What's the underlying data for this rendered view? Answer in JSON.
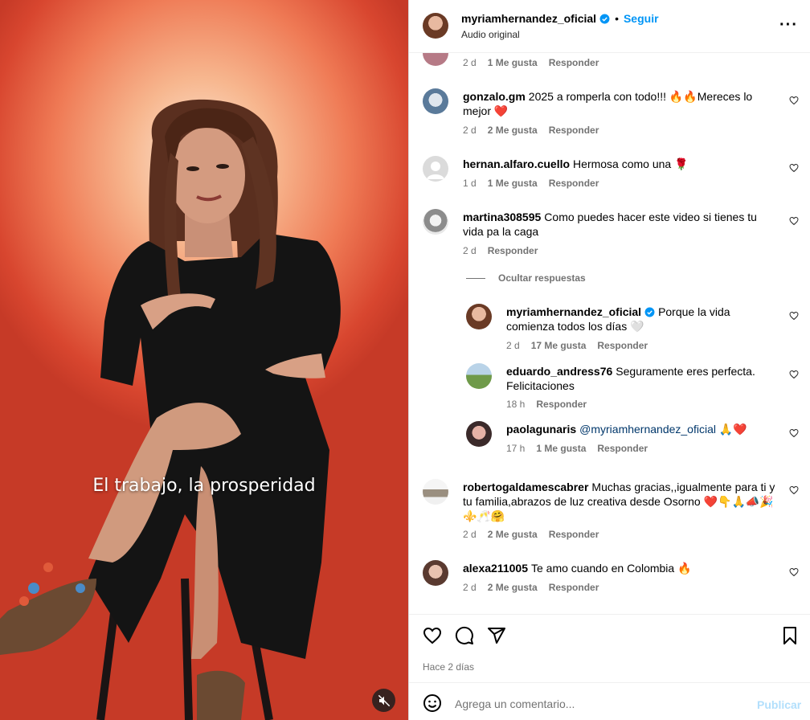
{
  "video": {
    "subtitle": "El trabajo, la prosperidad",
    "mute_icon": "speaker-muted-icon"
  },
  "post": {
    "author": "myriamhernandez_oficial",
    "separator": "•",
    "follow_label": "Seguir",
    "audio": "Audio original",
    "time_ago": "Hace 2 días"
  },
  "comments": [
    {
      "meta": {
        "age": "2 d",
        "likes": "1 Me gusta",
        "reply": "Responder"
      }
    },
    {
      "user": "gonzalo.gm",
      "text": "2025 a romperla con todo!!! 🔥🔥Mereces lo mejor ❤️",
      "meta": {
        "age": "2 d",
        "likes": "2 Me gusta",
        "reply": "Responder"
      }
    },
    {
      "user": "hernan.alfaro.cuello",
      "text": "Hermosa como una 🌹",
      "meta": {
        "age": "1 d",
        "likes": "1 Me gusta",
        "reply": "Responder"
      }
    },
    {
      "user": "martina308595",
      "text": "Como puedes hacer este video si tienes tu vida pa la caga",
      "meta": {
        "age": "2 d",
        "reply": "Responder"
      },
      "hide_replies": "Ocultar respuestas"
    },
    {
      "user": "myriamhernandez_oficial",
      "text": "Porque la vida comienza todos los días 🤍",
      "meta": {
        "age": "2 d",
        "likes": "17 Me gusta",
        "reply": "Responder"
      }
    },
    {
      "user": "eduardo_andress76",
      "text": "Seguramente eres perfecta. Felicitaciones",
      "meta": {
        "age": "18 h",
        "reply": "Responder"
      }
    },
    {
      "user": "paolagunaris",
      "text": "@myriamhernandez_oficial 🙏❤️",
      "meta": {
        "age": "17 h",
        "likes": "1 Me gusta",
        "reply": "Responder"
      }
    },
    {
      "user": "robertogaldamescabrer",
      "text": "Muchas gracias,,igualmente para ti y tu familia,abrazos de luz creativa desde Osorno ❤️👇🙏📣🎉⚜️🥂🤗",
      "meta": {
        "age": "2 d",
        "likes": "2 Me gusta",
        "reply": "Responder"
      }
    },
    {
      "user": "alexa211005",
      "text": "Te amo cuando en Colombia 🔥",
      "meta": {
        "age": "2 d",
        "likes": "2 Me gusta",
        "reply": "Responder"
      }
    }
  ],
  "composer": {
    "placeholder": "Agrega un comentario...",
    "publish_label": "Publicar"
  },
  "colors": {
    "accent": "#0095f6",
    "publish_disabled": "#b2dffc",
    "muted_text": "#737373",
    "like_red": "#ed4956"
  }
}
